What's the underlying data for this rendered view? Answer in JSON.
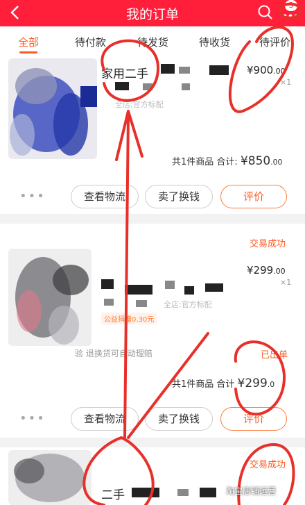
{
  "header": {
    "title": "我的订单",
    "badge": "3",
    "bg_color": "#ff1f3a"
  },
  "tabs": [
    {
      "label": "全部",
      "active": true
    },
    {
      "label": "待付款",
      "active": false
    },
    {
      "label": "待发货",
      "active": false
    },
    {
      "label": "待收货",
      "active": false
    },
    {
      "label": "待评价",
      "active": false
    }
  ],
  "orders": [
    {
      "name": "家用二手",
      "spec": "全店;官方标配",
      "price_int": "¥900",
      "price_dec": ".00",
      "qty": "×1",
      "total_label": "共1件商品 合计:",
      "total_int": "¥850",
      "total_dec": ".00",
      "buttons": [
        "查看物流",
        "卖了换钱",
        "评价"
      ]
    },
    {
      "status": "交易成功",
      "price_int": "¥299",
      "price_dec": ".00",
      "qty": "×1",
      "spec": "全店;官方标配",
      "tag": "公益捐赠0.30元",
      "service": "验   退换货可自动理赔",
      "shipped": "已出单",
      "total_label": "共1件商品 合计",
      "total_int": "¥299",
      "total_dec": ".0",
      "buttons": [
        "查看物流",
        "卖了换钱",
        "评价"
      ]
    },
    {
      "status": "交易成功",
      "name": "二手"
    }
  ],
  "watermark": "淘宝店铺运营",
  "colors": {
    "accent": "#ff5a1f",
    "annotation": "#e8302a"
  },
  "icons": [
    "back-arrow-icon",
    "search-icon",
    "more-icon"
  ]
}
